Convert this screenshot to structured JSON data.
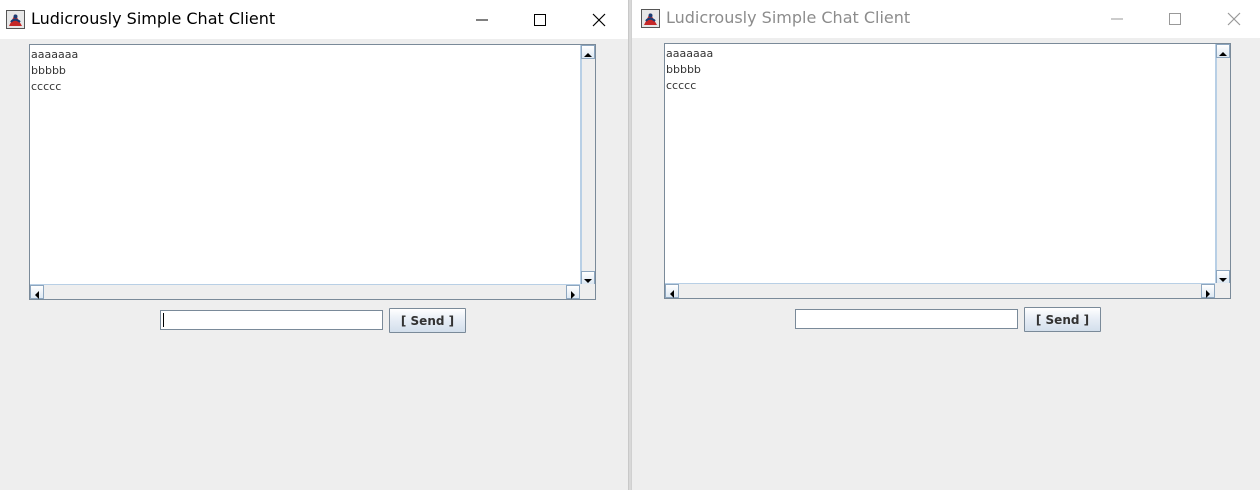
{
  "windows": [
    {
      "title": "Ludicrously Simple Chat Client",
      "active": true,
      "chat_lines": [
        "aaaaaaa",
        "bbbbb",
        "ccccc"
      ],
      "message_input": {
        "value": "",
        "placeholder": ""
      },
      "send_label": "[ Send ]"
    },
    {
      "title": "Ludicrously Simple Chat Client",
      "active": false,
      "chat_lines": [
        "aaaaaaa",
        "bbbbb",
        "ccccc"
      ],
      "message_input": {
        "value": "",
        "placeholder": ""
      },
      "send_label": "[ Send ]"
    }
  ],
  "icons": {
    "app": "java-app-icon",
    "minimize": "minimize-icon",
    "maximize": "maximize-icon",
    "close": "close-icon",
    "scroll_up": "arrow-up-icon",
    "scroll_down": "arrow-down-icon",
    "scroll_left": "arrow-left-icon",
    "scroll_right": "arrow-right-icon"
  },
  "colors": {
    "window_bg": "#eeeeee",
    "titlebar_bg": "#ffffff",
    "inactive_title": "#8c8c8c",
    "border": "#7a8a99",
    "scroll_border": "#8da6bf"
  }
}
